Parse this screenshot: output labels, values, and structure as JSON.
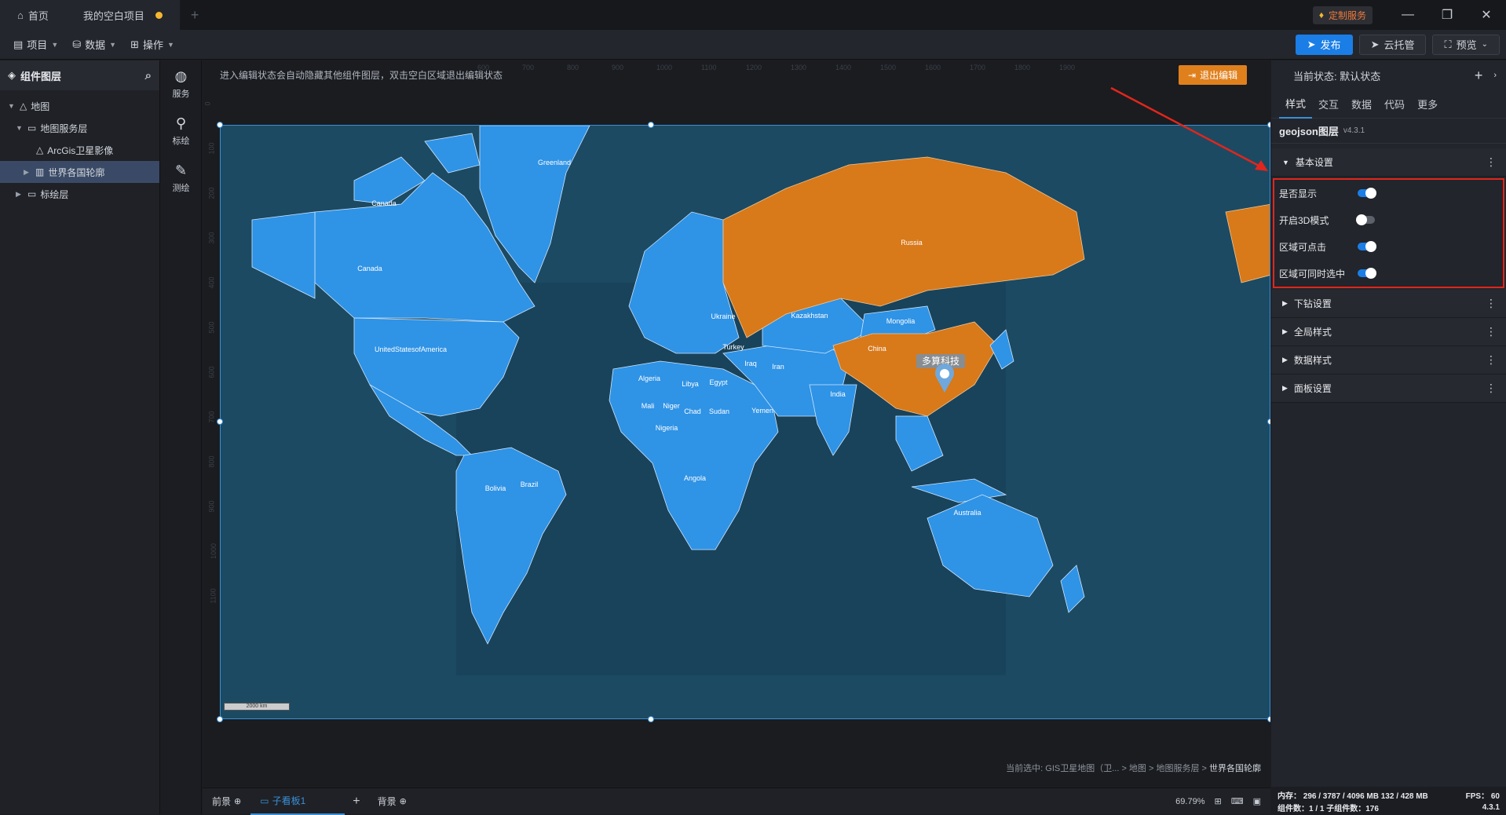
{
  "titlebar": {
    "tabs": [
      {
        "label": "首页"
      },
      {
        "label": "我的空白项目"
      }
    ],
    "service_badge": "定制服务"
  },
  "toolbar": {
    "menus": [
      {
        "label": "项目"
      },
      {
        "label": "数据"
      },
      {
        "label": "操作"
      }
    ],
    "publish_label": "发布",
    "cloud_label": "云托管",
    "preview_label": "预览"
  },
  "leftpanel": {
    "title": "组件图层",
    "tree": [
      {
        "label": "地图"
      },
      {
        "label": "地图服务层"
      },
      {
        "label": "ArcGis卫星影像"
      },
      {
        "label": "世界各国轮廓"
      },
      {
        "label": "标绘层"
      }
    ]
  },
  "iconstrip": {
    "items": [
      {
        "label": "服务"
      },
      {
        "label": "标绘"
      },
      {
        "label": "测绘"
      }
    ]
  },
  "canvas": {
    "hint": "进入编辑状态会自动隐藏其他组件图层，双击空白区域退出编辑状态",
    "exit_label": "退出编辑",
    "ruler_top": [
      "600",
      "700",
      "800",
      "900",
      "1000",
      "1100",
      "1200",
      "1300",
      "1400",
      "1500",
      "1600",
      "1700",
      "1800",
      "1900"
    ],
    "ruler_left": [
      "0",
      "100",
      "200",
      "300",
      "400",
      "500",
      "600",
      "700",
      "800",
      "900",
      "1000",
      "1100"
    ],
    "map_labels": [
      {
        "text": "Greenland"
      },
      {
        "text": "Canada"
      },
      {
        "text": "Canada"
      },
      {
        "text": "UnitedStatesofAmerica"
      },
      {
        "text": "Russia"
      },
      {
        "text": "Kazakhstan"
      },
      {
        "text": "Mongolia"
      },
      {
        "text": "China"
      },
      {
        "text": "Ukraine"
      },
      {
        "text": "Turkey"
      },
      {
        "text": "Iraq"
      },
      {
        "text": "Iran"
      },
      {
        "text": "India"
      },
      {
        "text": "Algeria"
      },
      {
        "text": "Libya"
      },
      {
        "text": "Egypt"
      },
      {
        "text": "Mali"
      },
      {
        "text": "Niger"
      },
      {
        "text": "Chad"
      },
      {
        "text": "Sudan"
      },
      {
        "text": "Yemen"
      },
      {
        "text": "Nigeria"
      },
      {
        "text": "Angola"
      },
      {
        "text": "Brazil"
      },
      {
        "text": "Bolivia"
      },
      {
        "text": "Australia"
      }
    ],
    "marker_label": "多算科技",
    "scale_label": "2000 km",
    "breadcrumb": "当前选中: GIS卫星地图（卫... > 地图 > 地图服务层 > ",
    "breadcrumb_current": "世界各国轮廓"
  },
  "bottombar": {
    "foreground": "前景",
    "subboard": "子看板1",
    "background": "背景",
    "zoom": "69.79%"
  },
  "rightpanel": {
    "state": "当前状态:  默认状态",
    "tabs": [
      {
        "label": "样式"
      },
      {
        "label": "交互"
      },
      {
        "label": "数据"
      },
      {
        "label": "代码"
      },
      {
        "label": "更多"
      }
    ],
    "layer_name": "geojson图层",
    "layer_version": "v4.3.1",
    "basic_section": "基本设置",
    "settings": [
      {
        "label": "是否显示",
        "on": true
      },
      {
        "label": "开启3D模式",
        "on": false
      },
      {
        "label": "区域可点击",
        "on": true
      },
      {
        "label": "区域可同时选中",
        "on": true
      }
    ],
    "sections": [
      {
        "label": "下钻设置"
      },
      {
        "label": "全局样式"
      },
      {
        "label": "数据样式"
      },
      {
        "label": "面板设置"
      }
    ]
  },
  "statusbar": {
    "memory": "内存： 296 / 3787 / 4096 MB 132 / 428 MB",
    "fps": "FPS： 60",
    "components": "组件数：1 / 1    子组件数：176",
    "version": "4.3.1"
  },
  "colors": {
    "accent": "#1b7ee6",
    "land": "#2f93e6",
    "highlight": "#d8791a",
    "ocean": "#1c4a63",
    "annotation": "#e1261c"
  }
}
